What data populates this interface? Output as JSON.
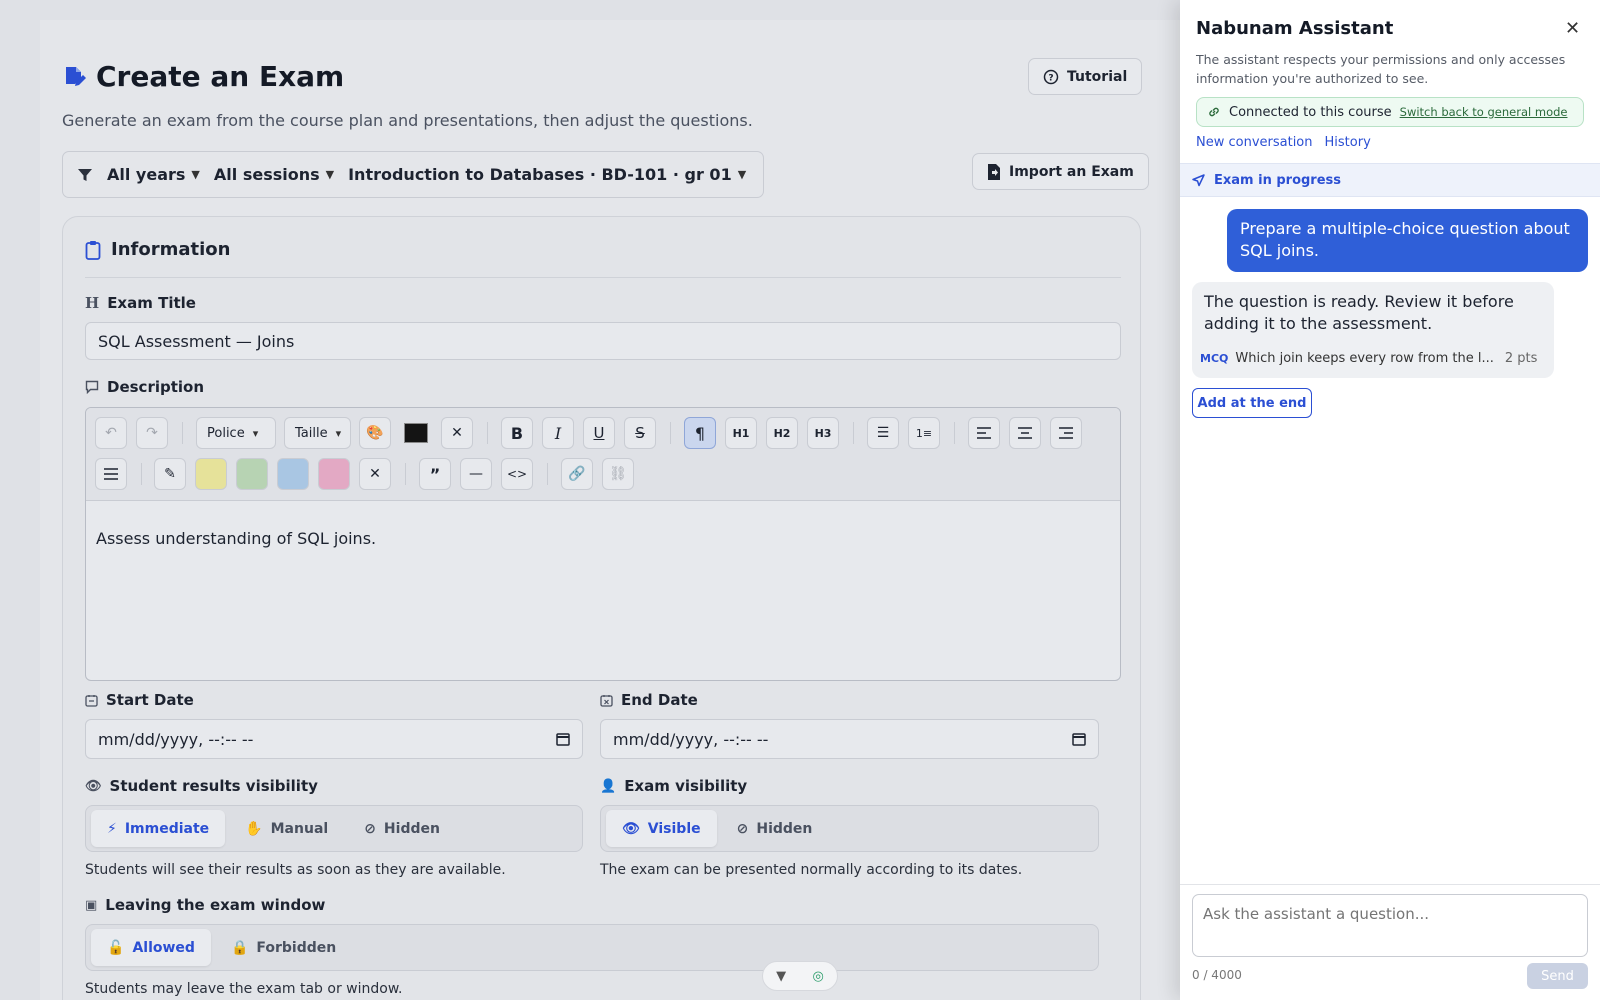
{
  "page": {
    "title": "Create an Exam",
    "subtitle": "Generate an exam from the course plan and presentations, then adjust the questions.",
    "tutorial_label": "Tutorial",
    "import_label": "Import an Exam",
    "filters": {
      "years": "All years",
      "sessions": "All sessions",
      "course": "Introduction to Databases · BD-101 · gr 01"
    }
  },
  "info": {
    "heading": "Information",
    "exam_title_label": "Exam Title",
    "exam_title_value": "SQL Assessment — Joins",
    "description_label": "Description",
    "font_select": "Police",
    "size_select": "Taille",
    "h1": "H1",
    "h2": "H2",
    "h3": "H3",
    "description_text": "Assess understanding of SQL joins.",
    "start_label": "Start Date",
    "start_placeholder": "mm/dd/yyyy, --:-- --",
    "end_label": "End Date",
    "end_placeholder": "mm/dd/yyyy, --:-- --",
    "results_label": "Student results visibility",
    "results_options": [
      "Immediate",
      "Manual",
      "Hidden"
    ],
    "results_help": "Students will see their results as soon as they are available.",
    "exam_vis_label": "Exam visibility",
    "exam_vis_options": [
      "Visible",
      "Hidden"
    ],
    "exam_vis_help": "The exam can be presented normally according to its dates.",
    "leaving_label": "Leaving the exam window",
    "leaving_options": [
      "Allowed",
      "Forbidden"
    ],
    "leaving_help": "Students may leave the exam tab or window."
  },
  "assistant": {
    "title": "Nabunam Assistant",
    "note": "The assistant respects your permissions and only accesses information you're authorized to see.",
    "connected": "Connected to this course",
    "switch_link": "Switch back to general mode",
    "new_conversation": "New conversation",
    "history": "History",
    "progress": "Exam in progress",
    "user_message": "Prepare a multiple-choice question about SQL joins.",
    "bot_message": "The question is ready. Review it before adding it to the assessment.",
    "question_type": "MCQ",
    "question_text": "Which join keeps every row from the l...",
    "question_points": "2 pts",
    "add_button": "Add at the end",
    "input_placeholder": "Ask the assistant a question...",
    "char_count": "0 / 4000",
    "send_label": "Send"
  },
  "colors": {
    "accent": "#2b4fd3",
    "user_bubble": "#2f5fd8",
    "connected_bg": "#eefaf2"
  }
}
